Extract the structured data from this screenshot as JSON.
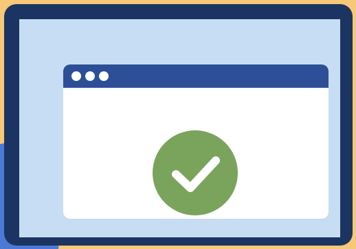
{
  "colors": {
    "background": "#f7c877",
    "accent_shape": "#4b7ad6",
    "monitor_frame": "#1b3461",
    "screen": "#c7ddf3",
    "browser_bar": "#2d4f97",
    "browser_window": "#ffffff",
    "check_circle": "#7aa35c",
    "check_mark": "#ffffff"
  },
  "icons": {
    "window_controls": [
      "window-dot-icon",
      "window-dot-icon",
      "window-dot-icon"
    ],
    "status": "checkmark-icon"
  }
}
